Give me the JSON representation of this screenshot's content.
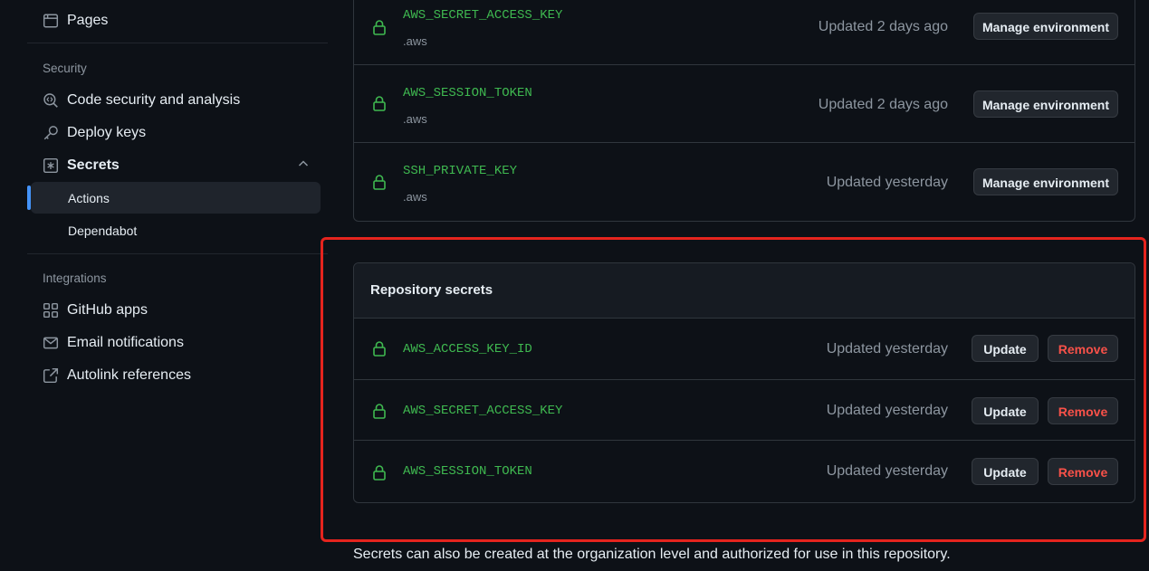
{
  "sidebar": {
    "pages": "Pages",
    "security_heading": "Security",
    "code_security": "Code security and analysis",
    "deploy_keys": "Deploy keys",
    "secrets": "Secrets",
    "actions": "Actions",
    "dependabot": "Dependabot",
    "integrations_heading": "Integrations",
    "github_apps": "GitHub apps",
    "email_notifications": "Email notifications",
    "autolink_references": "Autolink references"
  },
  "environment_secrets": [
    {
      "name": "AWS_SECRET_ACCESS_KEY",
      "env": ".aws",
      "updated": "Updated 2 days ago",
      "button": "Manage environment"
    },
    {
      "name": "AWS_SESSION_TOKEN",
      "env": ".aws",
      "updated": "Updated 2 days ago",
      "button": "Manage environment"
    },
    {
      "name": "SSH_PRIVATE_KEY",
      "env": ".aws",
      "updated": "Updated yesterday",
      "button": "Manage environment"
    }
  ],
  "repository_secrets": {
    "title": "Repository secrets",
    "items": [
      {
        "name": "AWS_ACCESS_KEY_ID",
        "updated": "Updated yesterday",
        "update": "Update",
        "remove": "Remove"
      },
      {
        "name": "AWS_SECRET_ACCESS_KEY",
        "updated": "Updated yesterday",
        "update": "Update",
        "remove": "Remove"
      },
      {
        "name": "AWS_SESSION_TOKEN",
        "updated": "Updated yesterday",
        "update": "Update",
        "remove": "Remove"
      }
    ]
  },
  "footnote": "Secrets can also be created at the organization level and authorized for use in this repository.",
  "colors": {
    "accent": "#4493f8",
    "secret_name": "#3fb950",
    "danger": "#f85149",
    "highlight": "#e5241e"
  }
}
